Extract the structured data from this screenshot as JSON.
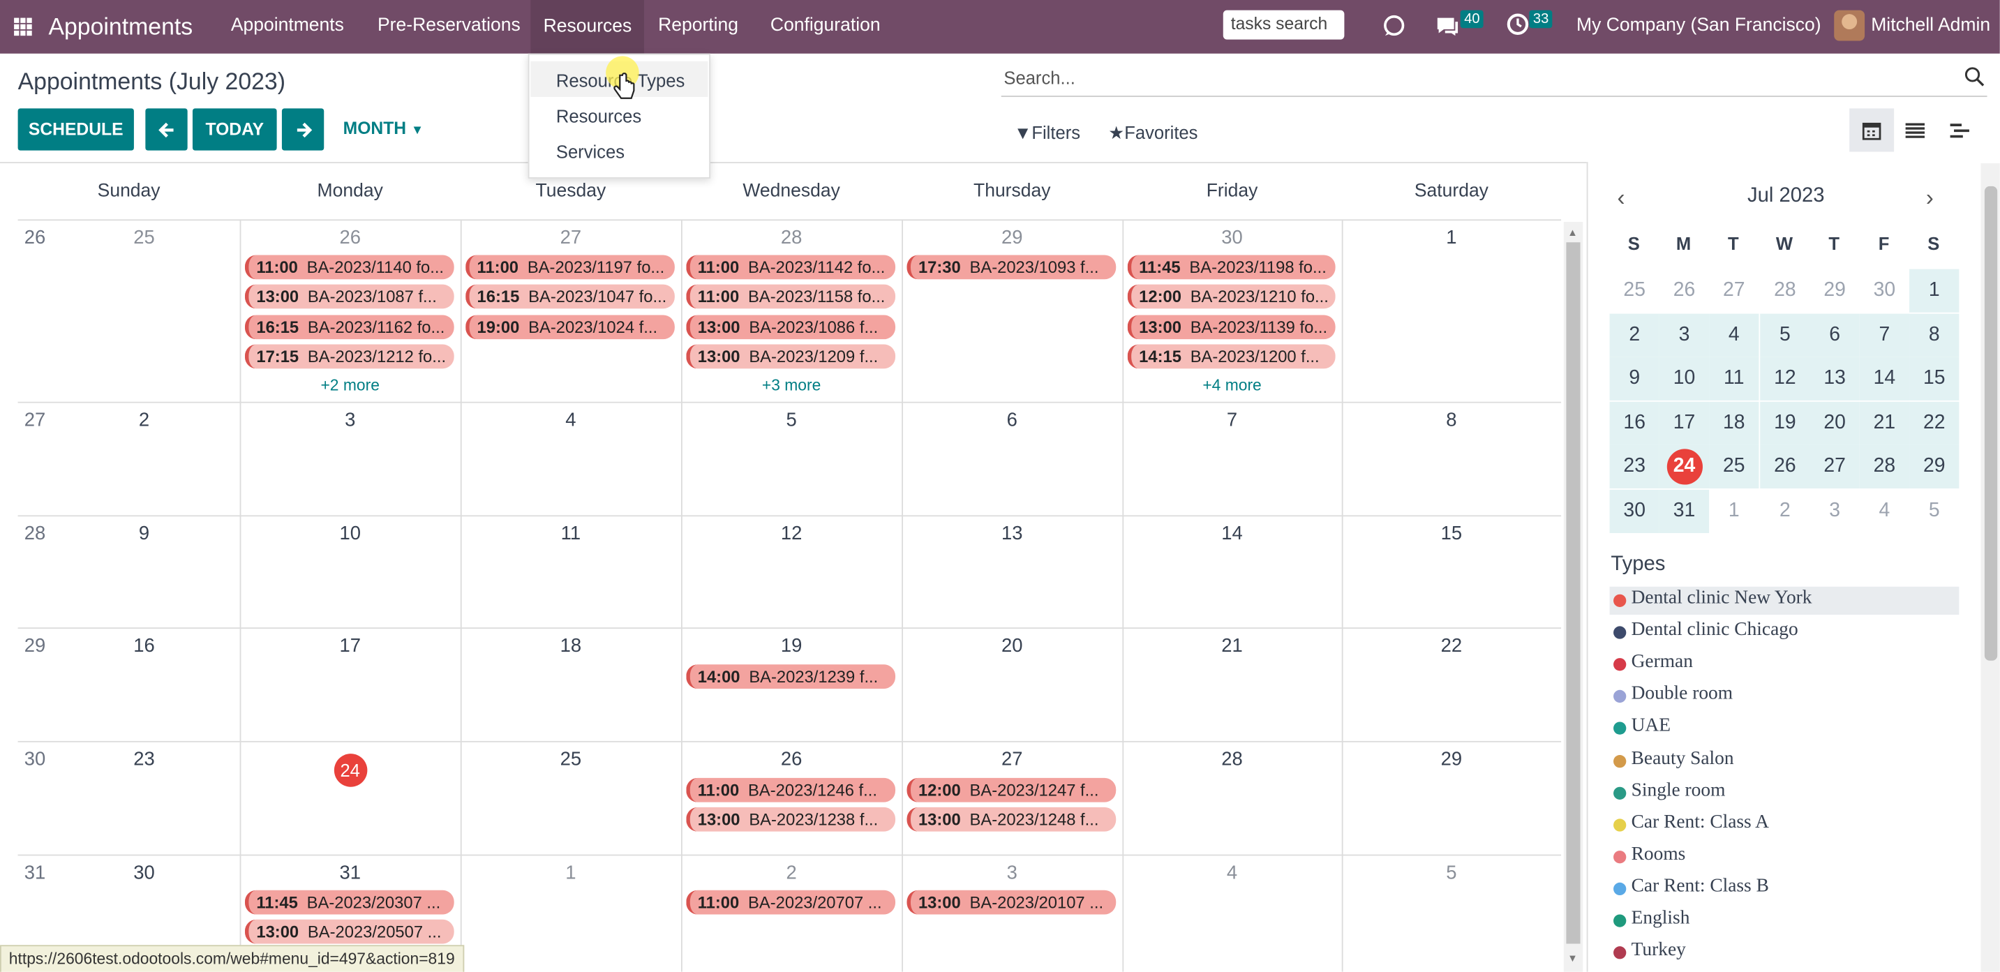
{
  "app": {
    "name": "Appointments",
    "menus": [
      "Appointments",
      "Pre-Reservations",
      "Resources",
      "Reporting",
      "Configuration"
    ],
    "tasks_search": "tasks search",
    "messages_count": "40",
    "activities_count": "33",
    "company": "My Company (San Francisco)",
    "user": "Mitchell Admin"
  },
  "dropdown": {
    "items": [
      "Resource Types",
      "Resources",
      "Services"
    ]
  },
  "control": {
    "title": "Appointments (July 2023)",
    "schedule_label": "SCHEDULE",
    "today_label": "TODAY",
    "scale_label": "MONTH",
    "search_placeholder": "Search...",
    "filters_label": "Filters",
    "favorites_label": "Favorites"
  },
  "calendar": {
    "day_headers": [
      "Sunday",
      "Monday",
      "Tuesday",
      "Wednesday",
      "Thursday",
      "Friday",
      "Saturday"
    ],
    "week_numbers": [
      "26",
      "27",
      "28",
      "29",
      "30",
      "31"
    ],
    "weeks": [
      [
        "25",
        "26",
        "27",
        "28",
        "29",
        "30",
        "1"
      ],
      [
        "2",
        "3",
        "4",
        "5",
        "6",
        "7",
        "8"
      ],
      [
        "9",
        "10",
        "11",
        "12",
        "13",
        "14",
        "15"
      ],
      [
        "16",
        "17",
        "18",
        "19",
        "20",
        "21",
        "22"
      ],
      [
        "23",
        "24",
        "25",
        "26",
        "27",
        "28",
        "29"
      ],
      [
        "30",
        "31",
        "1",
        "2",
        "3",
        "4",
        "5"
      ]
    ],
    "events": {
      "w0_mon": [
        [
          "11:00",
          "BA-2023/1140 fo..."
        ],
        [
          "13:00",
          "BA-2023/1087 f..."
        ],
        [
          "16:15",
          "BA-2023/1162 fo..."
        ],
        [
          "17:15",
          "BA-2023/1212 fo..."
        ]
      ],
      "w0_mon_more": "+2 more",
      "w0_tue": [
        [
          "11:00",
          "BA-2023/1197 fo..."
        ],
        [
          "16:15",
          "BA-2023/1047 fo..."
        ],
        [
          "19:00",
          "BA-2023/1024 f..."
        ]
      ],
      "w0_wed": [
        [
          "11:00",
          "BA-2023/1142 fo..."
        ],
        [
          "11:00",
          "BA-2023/1158 fo..."
        ],
        [
          "13:00",
          "BA-2023/1086 f..."
        ],
        [
          "13:00",
          "BA-2023/1209 f..."
        ]
      ],
      "w0_wed_more": "+3 more",
      "w0_thu": [
        [
          "17:30",
          "BA-2023/1093 f..."
        ]
      ],
      "w0_fri": [
        [
          "11:45",
          "BA-2023/1198 fo..."
        ],
        [
          "12:00",
          "BA-2023/1210 fo..."
        ],
        [
          "13:00",
          "BA-2023/1139 fo..."
        ],
        [
          "14:15",
          "BA-2023/1200 f..."
        ]
      ],
      "w0_fri_more": "+4 more",
      "w3_wed": [
        [
          "14:00",
          "BA-2023/1239 f..."
        ]
      ],
      "w4_wed": [
        [
          "11:00",
          "BA-2023/1246 f..."
        ],
        [
          "13:00",
          "BA-2023/1238 f..."
        ]
      ],
      "w4_thu": [
        [
          "12:00",
          "BA-2023/1247 f..."
        ],
        [
          "13:00",
          "BA-2023/1248 f..."
        ]
      ],
      "w5_mon": [
        [
          "11:45",
          "BA-2023/20307 ..."
        ],
        [
          "13:00",
          "BA-2023/20507 ..."
        ]
      ],
      "w5_wed": [
        [
          "11:00",
          "BA-2023/20707 ..."
        ]
      ],
      "w5_thu": [
        [
          "13:00",
          "BA-2023/20107 ..."
        ]
      ]
    }
  },
  "mini_calendar": {
    "month": "Jul 2023",
    "dow": [
      "S",
      "M",
      "T",
      "W",
      "T",
      "F",
      "S"
    ],
    "weeks": [
      [
        "25",
        "26",
        "27",
        "28",
        "29",
        "30",
        "1"
      ],
      [
        "2",
        "3",
        "4",
        "5",
        "6",
        "7",
        "8"
      ],
      [
        "9",
        "10",
        "11",
        "12",
        "13",
        "14",
        "15"
      ],
      [
        "16",
        "17",
        "18",
        "19",
        "20",
        "21",
        "22"
      ],
      [
        "23",
        "24",
        "25",
        "26",
        "27",
        "28",
        "29"
      ],
      [
        "30",
        "31",
        "1",
        "2",
        "3",
        "4",
        "5"
      ]
    ],
    "today": "24"
  },
  "types": {
    "heading": "Types",
    "items": [
      {
        "label": "Dental clinic New York",
        "color": "#e8564c"
      },
      {
        "label": "Dental clinic Chicago",
        "color": "#3d4a6b"
      },
      {
        "label": "German",
        "color": "#d63a48"
      },
      {
        "label": "Double room",
        "color": "#9aa3d6"
      },
      {
        "label": "UAE",
        "color": "#1e9c8f"
      },
      {
        "label": "Beauty Salon",
        "color": "#d39a4a"
      },
      {
        "label": "Single room",
        "color": "#2a9a86"
      },
      {
        "label": "Car Rent: Class A",
        "color": "#e6d04a"
      },
      {
        "label": "Rooms",
        "color": "#ea7b80"
      },
      {
        "label": "Car Rent: Class B",
        "color": "#5aa9e6"
      },
      {
        "label": "English",
        "color": "#1f9a7d"
      },
      {
        "label": "Turkey",
        "color": "#b03b50"
      }
    ]
  },
  "status_url": "https://2606test.odootools.com/web#menu_id=497&action=819"
}
